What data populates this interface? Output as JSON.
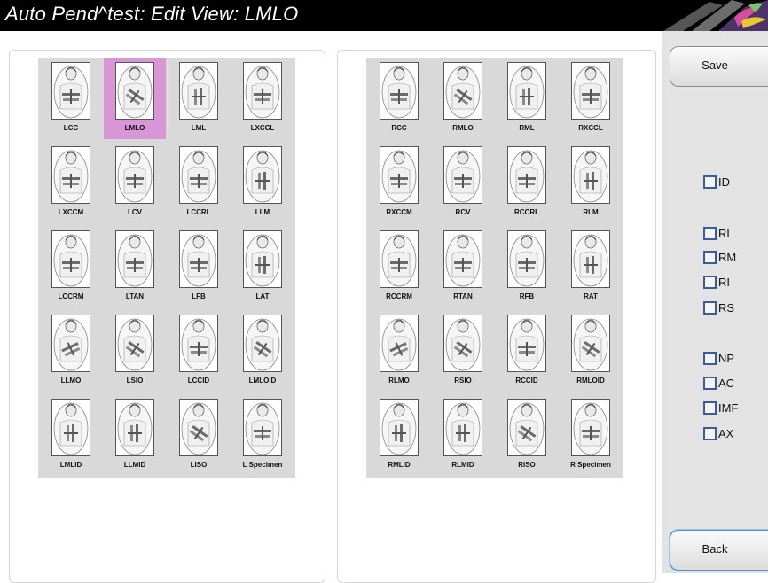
{
  "window": {
    "title": "Auto Pend^test: Edit View: LMLO"
  },
  "left_views": [
    {
      "label": "LCC",
      "icon": "lcc-view-icon",
      "selected": false
    },
    {
      "label": "LMLO",
      "icon": "lmlo-view-icon",
      "selected": true
    },
    {
      "label": "LML",
      "icon": "lml-view-icon",
      "selected": false
    },
    {
      "label": "LXCCL",
      "icon": "lxccl-view-icon",
      "selected": false
    },
    {
      "label": "LXCCM",
      "icon": "lxccm-view-icon",
      "selected": false
    },
    {
      "label": "LCV",
      "icon": "lcv-view-icon",
      "selected": false
    },
    {
      "label": "LCCRL",
      "icon": "lccrl-view-icon",
      "selected": false
    },
    {
      "label": "LLM",
      "icon": "llm-view-icon",
      "selected": false
    },
    {
      "label": "LCCRM",
      "icon": "lccrm-view-icon",
      "selected": false
    },
    {
      "label": "LTAN",
      "icon": "ltan-view-icon",
      "selected": false
    },
    {
      "label": "LFB",
      "icon": "lfb-view-icon",
      "selected": false
    },
    {
      "label": "LAT",
      "icon": "lat-view-icon",
      "selected": false
    },
    {
      "label": "LLMO",
      "icon": "llmo-view-icon",
      "selected": false
    },
    {
      "label": "LSIO",
      "icon": "lsio-view-icon",
      "selected": false
    },
    {
      "label": "LCCID",
      "icon": "lccid-view-icon",
      "selected": false
    },
    {
      "label": "LMLOID",
      "icon": "lmloid-view-icon",
      "selected": false
    },
    {
      "label": "LMLID",
      "icon": "lmlid-view-icon",
      "selected": false
    },
    {
      "label": "LLMID",
      "icon": "llmid-view-icon",
      "selected": false
    },
    {
      "label": "LISO",
      "icon": "liso-view-icon",
      "selected": false
    },
    {
      "label": "L Specimen",
      "icon": "l-specimen-view-icon",
      "selected": false
    }
  ],
  "right_views": [
    {
      "label": "RCC",
      "icon": "rcc-view-icon",
      "selected": false
    },
    {
      "label": "RMLO",
      "icon": "rmlo-view-icon",
      "selected": false
    },
    {
      "label": "RML",
      "icon": "rml-view-icon",
      "selected": false
    },
    {
      "label": "RXCCL",
      "icon": "rxccl-view-icon",
      "selected": false
    },
    {
      "label": "RXCCM",
      "icon": "rxccm-view-icon",
      "selected": false
    },
    {
      "label": "RCV",
      "icon": "rcv-view-icon",
      "selected": false
    },
    {
      "label": "RCCRL",
      "icon": "rccrl-view-icon",
      "selected": false
    },
    {
      "label": "RLM",
      "icon": "rlm-view-icon",
      "selected": false
    },
    {
      "label": "RCCRM",
      "icon": "rccrm-view-icon",
      "selected": false
    },
    {
      "label": "RTAN",
      "icon": "rtan-view-icon",
      "selected": false
    },
    {
      "label": "RFB",
      "icon": "rfb-view-icon",
      "selected": false
    },
    {
      "label": "RAT",
      "icon": "rat-view-icon",
      "selected": false
    },
    {
      "label": "RLMO",
      "icon": "rlmo-view-icon",
      "selected": false
    },
    {
      "label": "RSIO",
      "icon": "rsio-view-icon",
      "selected": false
    },
    {
      "label": "RCCID",
      "icon": "rccid-view-icon",
      "selected": false
    },
    {
      "label": "RMLOID",
      "icon": "rmloid-view-icon",
      "selected": false
    },
    {
      "label": "RMLID",
      "icon": "rmlid-view-icon",
      "selected": false
    },
    {
      "label": "RLMID",
      "icon": "rlmid-view-icon",
      "selected": false
    },
    {
      "label": "RISO",
      "icon": "riso-view-icon",
      "selected": false
    },
    {
      "label": "R Specimen",
      "icon": "r-specimen-view-icon",
      "selected": false
    }
  ],
  "sidebar": {
    "save_label": "Save",
    "back_label": "Back",
    "modifiers": [
      {
        "label": "ID",
        "checked": false
      },
      {
        "label": "RL",
        "checked": false
      },
      {
        "label": "RM",
        "checked": false
      },
      {
        "label": "RI",
        "checked": false
      },
      {
        "label": "RS",
        "checked": false
      },
      {
        "label": "NP",
        "checked": false
      },
      {
        "label": "AC",
        "checked": false
      },
      {
        "label": "IMF",
        "checked": false
      },
      {
        "label": "AX",
        "checked": false
      }
    ]
  },
  "colors": {
    "title_bar": "#000000",
    "selected_highlight": "#d896d6",
    "grid_background": "#d9d9d9",
    "checkbox_border": "#3a5d9a",
    "sidebar_background": "#e3e3e3"
  }
}
